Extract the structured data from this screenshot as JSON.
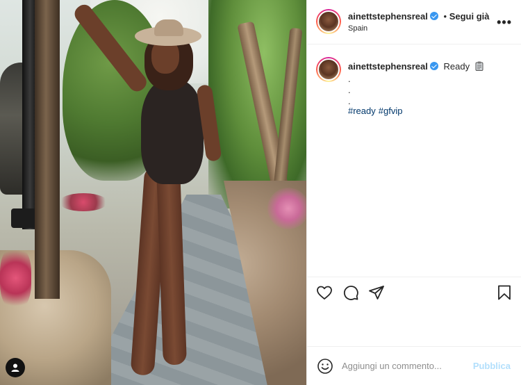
{
  "post": {
    "username": "ainettstephensreal",
    "follow_separator": "•",
    "follow_label": "Segui già",
    "location": "Spain",
    "more_label": "•••",
    "caption": {
      "text": "Ready",
      "dots": [
        ".",
        ".",
        "."
      ],
      "hashtags": [
        "#ready",
        "#gfvip"
      ]
    }
  },
  "comment_box": {
    "placeholder": "Aggiungi un commento...",
    "publish_label": "Pubblica"
  },
  "icons": {
    "verified": "verified-badge-icon",
    "heart": "heart-icon",
    "comment": "comment-icon",
    "share": "share-icon",
    "save": "bookmark-icon",
    "emoji": "emoji-icon",
    "more": "more-options-icon",
    "clip": "clipboard-emoji-icon",
    "user": "user-icon"
  },
  "colors": {
    "verified_blue": "#3897f0",
    "hashtag": "#00376b",
    "publish_disabled": "#b2dffc",
    "muted_text": "#8e8e8e",
    "border": "#efefef"
  }
}
